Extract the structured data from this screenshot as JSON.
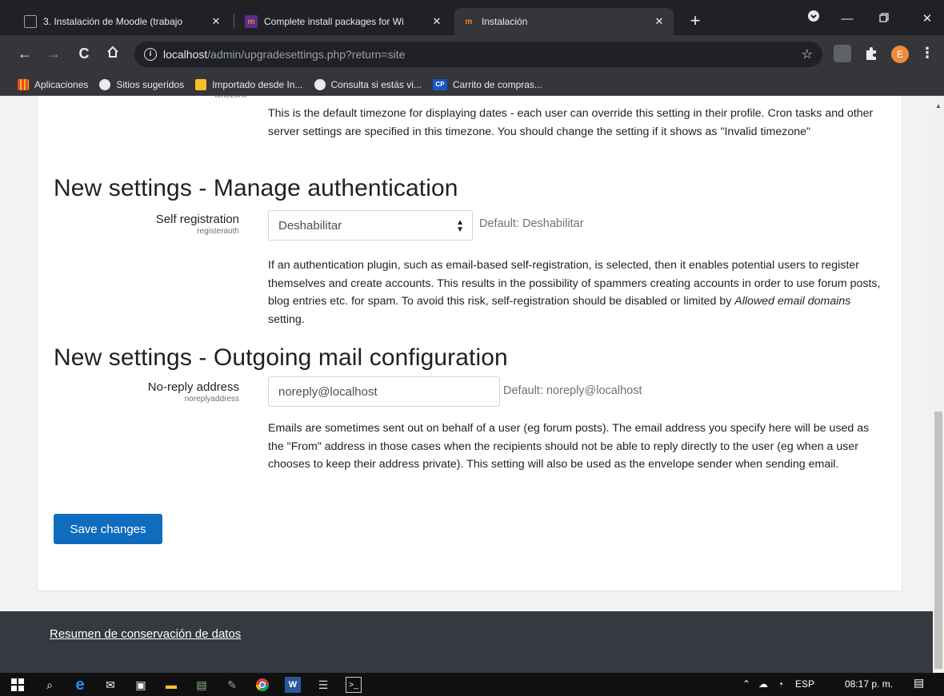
{
  "browser": {
    "tabs": [
      {
        "title": "3. Instalación de Moodle (trabajo",
        "close": "✕",
        "favicon_color": "#9aa0a6"
      },
      {
        "title": "Complete install packages for Wi",
        "close": "✕",
        "favicon_color": "#5c2d91"
      },
      {
        "title": "Instalación",
        "close": "✕",
        "favicon_color": "#f98012"
      }
    ],
    "new_tab": "+",
    "address": {
      "host": "localhost",
      "path": "/admin/upgradesettings.php?return=site"
    },
    "profile_initial": "E",
    "bookmarks": [
      {
        "label": "Aplicaciones",
        "icon": "apps-grid-icon"
      },
      {
        "label": "Sitios sugeridos",
        "icon": "globe-icon"
      },
      {
        "label": "Importado desde In...",
        "icon": "folder-icon"
      },
      {
        "label": "Consulta si estás vi...",
        "icon": "globe-icon"
      },
      {
        "label": "Carrito de compras...",
        "icon": "cp-icon",
        "badge": "CP"
      }
    ]
  },
  "page": {
    "timezone": {
      "key": "timezone",
      "description": "This is the default timezone for displaying dates - each user can override this setting in their profile. Cron tasks and other server settings are specified in this timezone. You should change the setting if it shows as \"Invalid timezone\""
    },
    "section_auth": {
      "heading": "New settings - Manage authentication",
      "setting_title": "Self registration",
      "setting_key": "registerauth",
      "select_value": "Deshabilitar",
      "default_text": "Default: Deshabilitar",
      "description_before": "If an authentication plugin, such as email-based self-registration, is selected, then it enables potential users to register themselves and create accounts. This results in the possibility of spammers creating accounts in order to use forum posts, blog entries etc. for spam. To avoid this risk, self-registration should be disabled or limited by ",
      "description_em": "Allowed email domains",
      "description_after": " setting."
    },
    "section_mail": {
      "heading": "New settings - Outgoing mail configuration",
      "setting_title": "No-reply address",
      "setting_key": "noreplyaddress",
      "input_value": "noreply@localhost",
      "default_text": "Default: noreply@localhost",
      "description": "Emails are sometimes sent out on behalf of a user (eg forum posts). The email address you specify here will be used as the \"From\" address in those cases when the recipients should not be able to reply directly to the user (eg when a user chooses to keep their address private). This setting will also be used as the envelope sender when sending email."
    },
    "save_button": "Save changes",
    "footer_link": "Resumen de conservación de datos"
  },
  "taskbar": {
    "language": "ESP",
    "time": "08:17 p. m."
  },
  "colors": {
    "primary": "#0f6cbf",
    "footer": "#343a40",
    "chrome_dark": "#202124"
  }
}
